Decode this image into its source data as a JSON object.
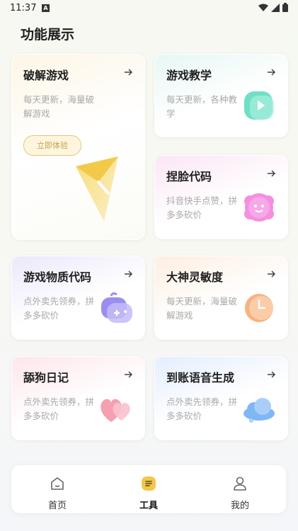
{
  "status_bar": {
    "time": "11:37",
    "a_badge": "A"
  },
  "page": {
    "title": "功能展示"
  },
  "cards": {
    "crack": {
      "title": "破解游戏",
      "desc": "每天更新，海量破解游戏",
      "button": "立即体验"
    },
    "teach": {
      "title": "游戏教学",
      "desc": "每天更新，各种教学"
    },
    "face": {
      "title": "捏脸代码",
      "desc": "抖音快手点赞，拼多多砍价"
    },
    "material": {
      "title": "游戏物质代码",
      "desc": "点外卖先领券，拼多多砍价"
    },
    "sensitivity": {
      "title": "大神灵敏度",
      "desc": "每天更新，海量破解游戏"
    },
    "diary": {
      "title": "舔狗日记",
      "desc": "点外卖先领券，拼多多砍价"
    },
    "voice": {
      "title": "到账语音生成",
      "desc": "点外卖先领券，拼多多砍价"
    }
  },
  "nav": {
    "home": "首页",
    "tools": "工具",
    "mine": "我的"
  },
  "colors": {
    "accent_yellow": "#f1c84b",
    "desc_gray": "#a9a9a9"
  }
}
